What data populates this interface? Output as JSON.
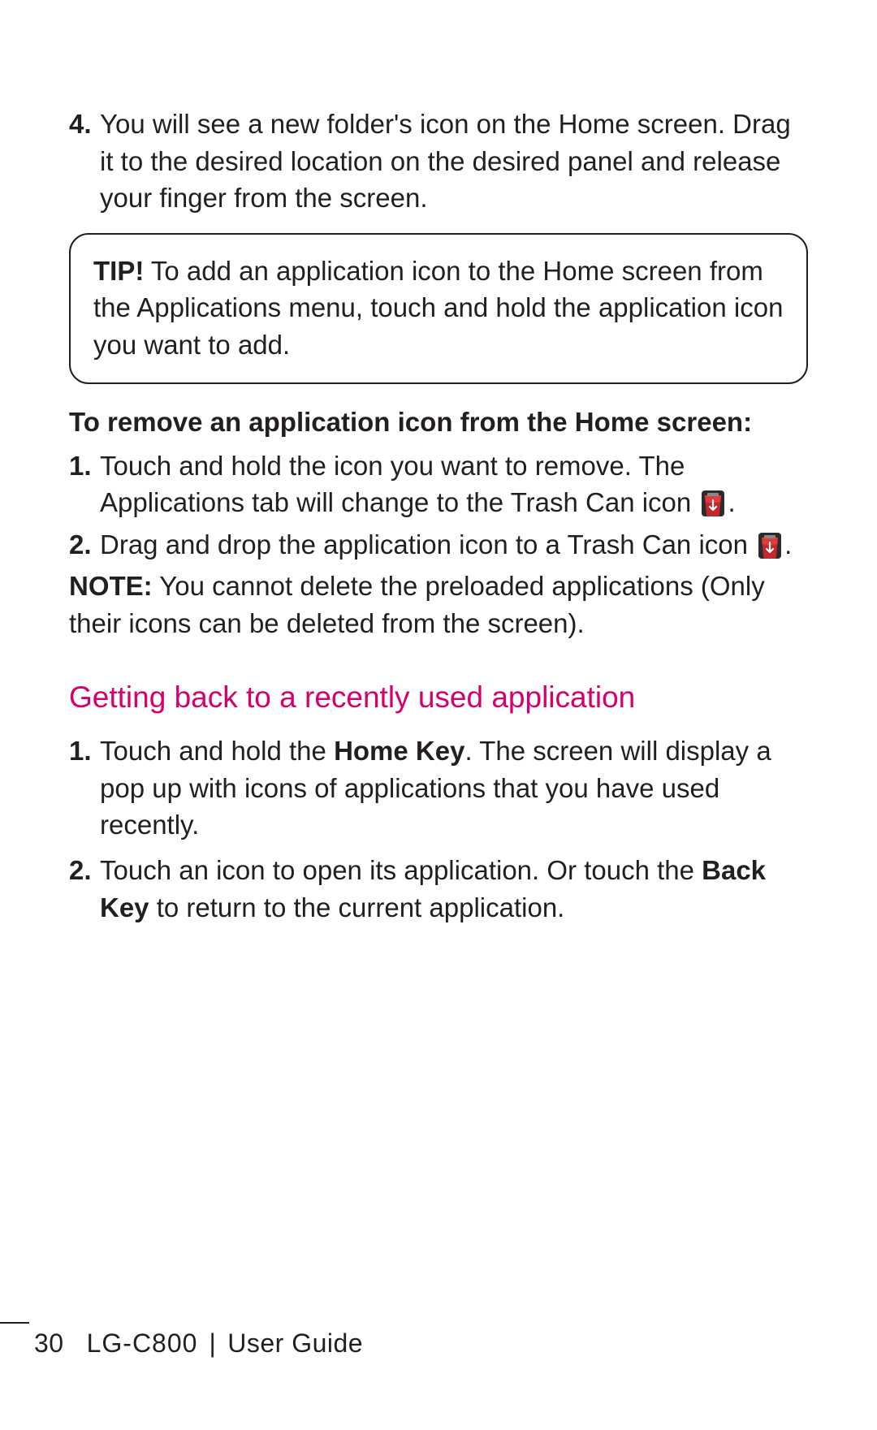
{
  "step4": {
    "num": "4.",
    "text": "You will see a new folder's icon on the Home screen. Drag it to the desired location on the desired panel and release your finger from the screen."
  },
  "tip": {
    "lead": "TIP!",
    "text": " To add an application icon to the Home screen from the Applications menu, touch and hold the application icon you want to add."
  },
  "remove": {
    "heading": "To remove an application icon from the Home screen:",
    "items": [
      {
        "num": "1.",
        "pre": "Touch and hold the icon you want to remove. The Applications tab will change to the Trash Can icon ",
        "post": "."
      },
      {
        "num": "2.",
        "pre": "Drag and drop the application icon to a Trash Can icon ",
        "post": "."
      }
    ]
  },
  "note": {
    "lead": "NOTE:",
    "text": " You cannot delete the preloaded applications (Only their icons can be deleted from the screen)."
  },
  "section_title": "Getting back to a recently used application",
  "recent": {
    "items": [
      {
        "num": "1.",
        "p1": "Touch and hold the ",
        "b1": "Home Key",
        "p2": ". The screen will display a pop up with icons of applications that you have used recently."
      },
      {
        "num": "2.",
        "p1": "Touch an icon to open its application. Or touch the ",
        "b1": "Back Key",
        "p2": " to return to the current application."
      }
    ]
  },
  "footer": {
    "page": "30",
    "model": "LG-C800",
    "divider": "|",
    "label": "User Guide"
  }
}
